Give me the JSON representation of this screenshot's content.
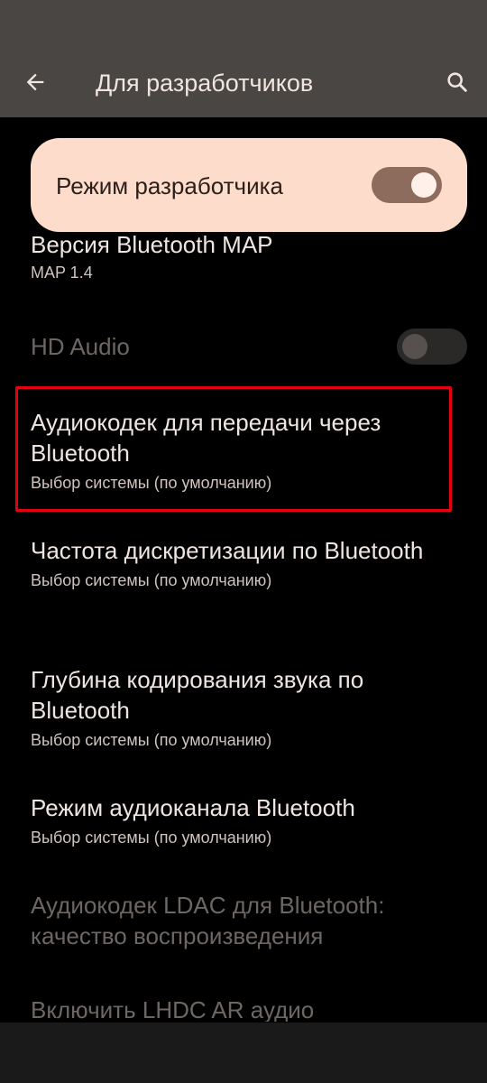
{
  "header": {
    "title": "Для разработчиков",
    "back_icon": "arrow-back-icon",
    "search_icon": "search-icon"
  },
  "master": {
    "label": "Режим разработчика",
    "enabled": true
  },
  "items": [
    {
      "title": "Версия Bluetooth MAP",
      "subtitle": "MAP 1.4"
    },
    {
      "title": "HD Audio",
      "enabled": false,
      "toggle": "off"
    },
    {
      "title": "Аудиокодек для передачи через Bluetooth",
      "subtitle": "Выбор системы (по умолчанию)",
      "highlighted": true
    },
    {
      "title": "Частота дискретизации по Bluetooth",
      "subtitle": "Выбор системы (по умолчанию)"
    },
    {
      "title": "Глубина кодирования звука по Bluetooth",
      "subtitle": "Выбор системы (по умолчанию)"
    },
    {
      "title": "Режим аудиоканала Bluetooth",
      "subtitle": "Выбор системы (по умолчанию)"
    },
    {
      "title": "Аудиокодек LDAC для Bluetooth: качество воспроизведения",
      "enabled": false
    },
    {
      "title": "Включить LHDC AR аудио",
      "enabled": false
    }
  ],
  "colors": {
    "topbar": "#4a4643",
    "card": "#fddccc",
    "highlight": "#e4000f"
  }
}
